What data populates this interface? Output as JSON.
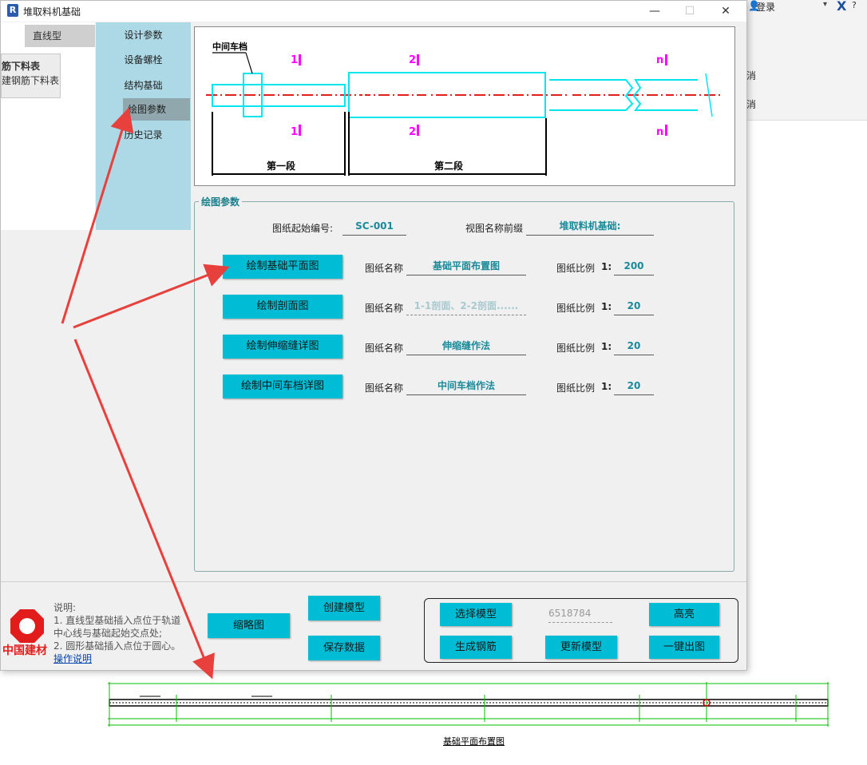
{
  "window": {
    "title": "堆取料机基础",
    "app_icon": "R",
    "min_glyph": "—",
    "max_glyph": "☐",
    "close_glyph": "✕"
  },
  "background_app": {
    "login": "登录",
    "item1": "消",
    "item2": "消"
  },
  "left_panel": {
    "type_tab": "直线型",
    "rebar_title": "筋下料表",
    "rebar_sub": "建钢筋下料表"
  },
  "nav": {
    "items": [
      "设计参数",
      "设备螺栓",
      "结构基础",
      "绘图参数",
      "历史记录"
    ],
    "active_index": 3
  },
  "preview": {
    "label_middle": "中间车档",
    "mark1": "1",
    "mark2": "2",
    "markn": "n",
    "segment1": "第一段",
    "segment2": "第二段"
  },
  "drawing_params": {
    "group_title": "绘图参数",
    "start_no_label": "图纸起始编号:",
    "start_no_value": "SC-001",
    "view_prefix_label": "视图名称前缀",
    "view_prefix_value": "堆取料机基础:",
    "sheet_name_label": "图纸名称",
    "scale_label": "图纸比例",
    "scale_prefix": "1:",
    "rows": [
      {
        "button": "绘制基础平面图",
        "sheet_name": "基础平面布置图",
        "placeholder": false,
        "scale": "200"
      },
      {
        "button": "绘制剖面图",
        "sheet_name": "1-1剖面、2-2剖面......",
        "placeholder": true,
        "scale": "20"
      },
      {
        "button": "绘制伸缩缝详图",
        "sheet_name": "伸缩缝作法",
        "placeholder": false,
        "scale": "20"
      },
      {
        "button": "绘制中间车档详图",
        "sheet_name": "中间车档作法",
        "placeholder": false,
        "scale": "20"
      }
    ]
  },
  "bottom": {
    "thumbnail": "缩略图",
    "create_model": "创建模型",
    "save_data": "保存数据",
    "select_model": "选择模型",
    "model_id": "6518784",
    "highlight": "高亮",
    "gen_rebar": "生成钢筋",
    "update_model": "更新模型",
    "export_all": "一键出图"
  },
  "notes": {
    "title": "说明:",
    "line1": "1. 直线型基础插入点位于轨道中心线与基础起始交点处;",
    "line2": "2. 圆形基础插入点位于圆心。",
    "link": "操作说明",
    "logo_text": "中国建材"
  },
  "drawing": {
    "caption": "基础平面布置图"
  },
  "colors": {
    "nav_bg": "#add8e6",
    "button": "#00bcd4",
    "accent_text": "#1a8a9a",
    "arrow": "#e8403c",
    "cyan_line": "#00e5ee",
    "magenta": "#ff00ff",
    "red_dash": "#e0201a",
    "green": "#00c000"
  }
}
